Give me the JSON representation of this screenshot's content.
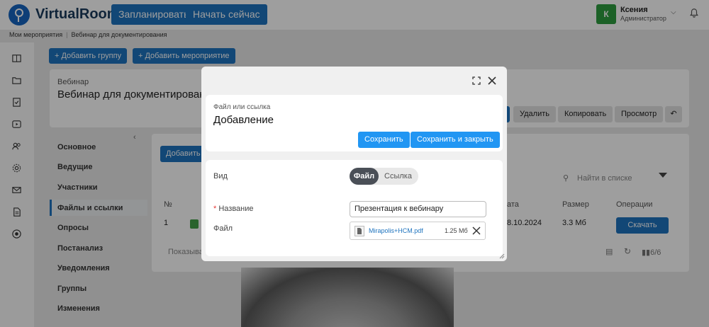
{
  "app": {
    "brand": "VirtualRoom"
  },
  "topbar": {
    "plan_label": "Запланировать",
    "start_label": "Начать сейчас",
    "user": {
      "initial": "К",
      "name": "Ксения",
      "role": "Администратор"
    }
  },
  "breadcrumb": {
    "items": [
      "Мои мероприятия",
      "Вебинар для документирования"
    ]
  },
  "actions": {
    "add_group": "Добавить группу",
    "add_event": "Добавить мероприятие"
  },
  "event": {
    "type": "Вебинар",
    "title": "Вебинар для документирован",
    "buttons": [
      "Удалить",
      "Копировать",
      "Просмотр"
    ]
  },
  "sidemenu": [
    "Основное",
    "Ведущие",
    "Участники",
    "Файлы и ссылки",
    "Опросы",
    "Постанализ",
    "Уведомления",
    "Группы",
    "Изменения"
  ],
  "files": {
    "add_label": "Добавить ф",
    "search_placeholder": "Найти в списке",
    "headers": {
      "num": "№",
      "date": "ата",
      "size": "Размер",
      "ops": "Операции"
    },
    "row": {
      "num": "1",
      "date": "8.10.2024",
      "size": "3.3 Мб",
      "download": "Скачать"
    },
    "footer": "Показыва",
    "count": "6/6"
  },
  "modal": {
    "subtitle": "Файл или ссылка",
    "title": "Добавление",
    "save": "Сохранить",
    "save_close": "Сохранить и закрыть",
    "type_label": "Вид",
    "type_options": [
      "Файл",
      "Ссылка"
    ],
    "name_required": "*",
    "name_label": "Название",
    "name_value": "Презентация к вебинару",
    "file_label": "Файл",
    "file_name": "Mirapolis+HCM.pdf",
    "file_size": "1.25 Мб"
  },
  "colors": {
    "primary": "#1e73be",
    "modal_primary": "#2196f3",
    "avatar": "#2e9d3f",
    "required": "#e53935"
  }
}
